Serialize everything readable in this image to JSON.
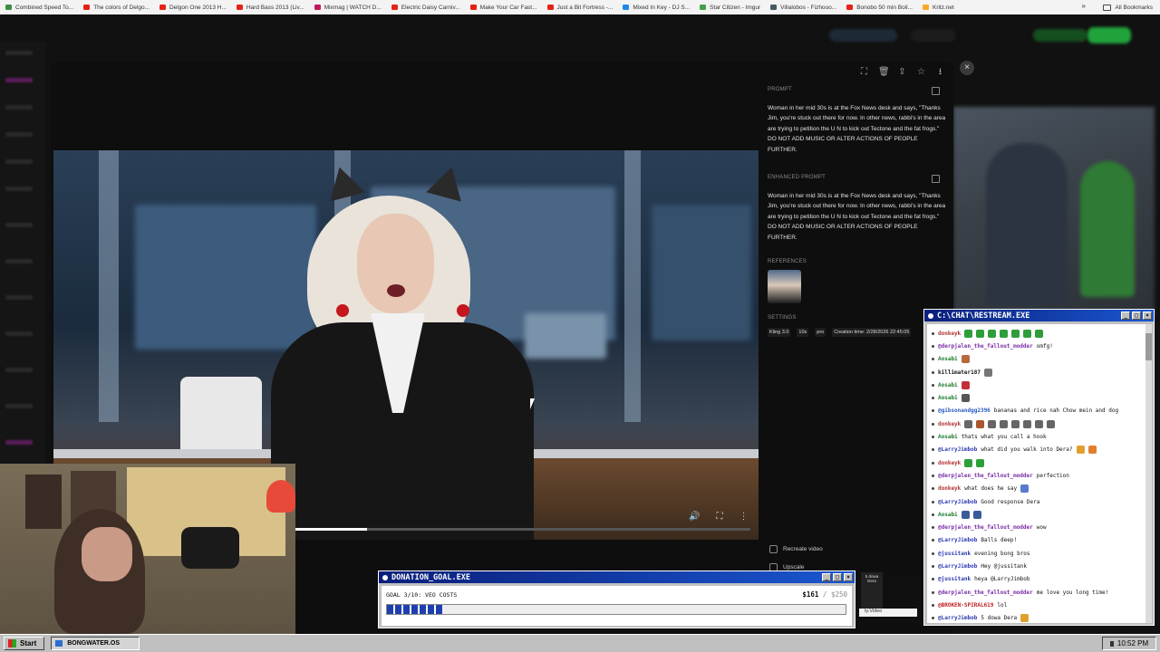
{
  "bookmarks": {
    "items": [
      {
        "label": "Combined Speed To...",
        "color": "#3c8d40"
      },
      {
        "label": "The colors of Delgo...",
        "color": "#e62117"
      },
      {
        "label": "Delgon One 2013 H...",
        "color": "#e62117"
      },
      {
        "label": "Hard Bass 2013 (Liv...",
        "color": "#e62117"
      },
      {
        "label": "Mixmag | WATCH D...",
        "color": "#c2185b"
      },
      {
        "label": "Electric Daisy Carniv...",
        "color": "#e62117"
      },
      {
        "label": "Make Your Car Fast...",
        "color": "#e62117"
      },
      {
        "label": "Just a Bit Fortress -...",
        "color": "#e62117"
      },
      {
        "label": "Mixed In Key - DJ S...",
        "color": "#1e88e5"
      },
      {
        "label": "Star Citizen - Imgur",
        "color": "#43a047"
      },
      {
        "label": "Villalobos - Fizhouo...",
        "color": "#455a64"
      },
      {
        "label": "Bonobo 50 min Boil...",
        "color": "#e62117"
      },
      {
        "label": "Kritz.net",
        "color": "#f9a825"
      }
    ],
    "more": "»",
    "all_bookmarks": "All Bookmarks"
  },
  "modal": {
    "close": "×",
    "toolbar_icons": [
      "expand-icon",
      "trash-icon",
      "share-icon",
      "star-icon",
      "download-icon"
    ],
    "prompt_label": "PROMPT",
    "prompt_text": "Woman in her mid 30s is at the Fox News desk and says, \"Thanks Jim, you're stuck out there for now. In other news, rabbi's in the area are trying to petition the U N to kick out Tectone and the fat frogs.\" DO NOT ADD MUSIC OR ALTER ACTIONS OF PEOPLE FURTHER.",
    "enhanced_label": "ENHANCED PROMPT",
    "enhanced_text": "Woman in her mid 30s is at the Fox News desk and says, \"Thanks Jim, you're stuck out there for now. In other news, rabbi's in the area are trying to petition the U N to kick out Tectone and the fat frogs.\" DO NOT ADD MUSIC OR ALTER ACTIONS OF PEOPLE FURTHER.",
    "references_label": "REFERENCES",
    "settings_label": "SETTINGS",
    "settings": [
      "Kling 3.0",
      "10s",
      "pro",
      "Creation time: 2/28/2026 22:45:05"
    ],
    "recreate_label": "Recreate video",
    "upscale_label": "Upscale",
    "video_progress": 0.16
  },
  "chat": {
    "title": "C:\\CHAT\\RESTREAM.EXE",
    "buttons": [
      "_",
      "□",
      "×"
    ],
    "messages": [
      {
        "user": "donkeyk",
        "user_color": "#b03030",
        "text": "",
        "emotes": [
          "#2e9e3a",
          "#2e9e3a",
          "#2e9e3a",
          "#2e9e3a",
          "#2e9e3a",
          "#2e9e3a",
          "#2e9e3a"
        ]
      },
      {
        "user": "@derpjalen_the_fallout_modder",
        "user_color": "#7a2ca8",
        "text": "omfg!",
        "emotes": []
      },
      {
        "user": "Aosabi",
        "user_color": "#1b7a2a",
        "text": "",
        "emotes": [
          "#b86a3a"
        ]
      },
      {
        "user": "killimater187",
        "user_color": "#111111",
        "text": "",
        "emotes": [
          "#777777"
        ]
      },
      {
        "user": "Aosabi",
        "user_color": "#1b7a2a",
        "text": "",
        "emotes": [
          "#c0303a"
        ]
      },
      {
        "user": "Aosabi",
        "user_color": "#1b7a2a",
        "text": "",
        "emotes": [
          "#555555"
        ]
      },
      {
        "user": "@gibsonandgg2396",
        "user_color": "#2a5ac0",
        "text": "bananas and rice nah Chow mein and dog",
        "emotes": []
      },
      {
        "user": "donkeyk",
        "user_color": "#b03030",
        "text": "",
        "emotes": [
          "#666666",
          "#a8562a",
          "#666666",
          "#666666",
          "#666666",
          "#666666",
          "#666666",
          "#666666"
        ]
      },
      {
        "user": "Aosabi",
        "user_color": "#1b7a2a",
        "text": "thats what you call a hook",
        "emotes": []
      },
      {
        "user": "@LarryJimbob",
        "user_color": "#2a3ab0",
        "text": "what did you walk into Dera?",
        "emotes": [
          "#e0a030",
          "#e08030"
        ]
      },
      {
        "user": "donkeyk",
        "user_color": "#b03030",
        "text": "",
        "emotes": [
          "#2e9e3a",
          "#2e9e3a"
        ]
      },
      {
        "user": "@derpjalen_the_fallout_modder",
        "user_color": "#7a2ca8",
        "text": "perfection",
        "emotes": []
      },
      {
        "user": "donkeyk",
        "user_color": "#b03030",
        "text": "what does he say",
        "emotes": [
          "#5a7ad0"
        ]
      },
      {
        "user": "@LarryJimbob",
        "user_color": "#2a3ab0",
        "text": "Good response Dera",
        "emotes": []
      },
      {
        "user": "Aosabi",
        "user_color": "#1b7a2a",
        "text": "",
        "emotes": [
          "#3a5a9a",
          "#3a5a9a"
        ]
      },
      {
        "user": "@derpjalen_the_fallout_modder",
        "user_color": "#7a2ca8",
        "text": "wow",
        "emotes": []
      },
      {
        "user": "@LarryJimbob",
        "user_color": "#2a3ab0",
        "text": "Balls deep!",
        "emotes": []
      },
      {
        "user": "@jussitank",
        "user_color": "#2a3ab0",
        "text": "evening bong bros",
        "emotes": []
      },
      {
        "user": "@LarryJimbob",
        "user_color": "#2a3ab0",
        "text": "Hey @jussitank",
        "emotes": []
      },
      {
        "user": "@jussitank",
        "user_color": "#2a3ab0",
        "text": "heya @LarryJimbob",
        "emotes": []
      },
      {
        "user": "@derpjalen_the_fallout_modder",
        "user_color": "#7a2ca8",
        "text": "me love you long time!",
        "emotes": []
      },
      {
        "user": "@BROKEN-SPIRAL619",
        "user_color": "#c02020",
        "text": "lol",
        "emotes": []
      },
      {
        "user": "@LarryJimbob",
        "user_color": "#2a3ab0",
        "text": "5 dowa Dera",
        "emotes": [
          "#e0a030"
        ]
      }
    ]
  },
  "donation": {
    "title": "DONATION_GOAL.EXE",
    "buttons": [
      "_",
      "□",
      "×"
    ],
    "goal_text": "GOAL 3/10: VEO COSTS",
    "current": "$161",
    "separator": "/",
    "target": "$250",
    "progress": 0.12,
    "side_label": "ty.Video",
    "side_mini": "5 dowa Dera"
  },
  "taskbar": {
    "start": "Start",
    "task": "BONGWATER.OS",
    "clock": "10:52 PM"
  }
}
